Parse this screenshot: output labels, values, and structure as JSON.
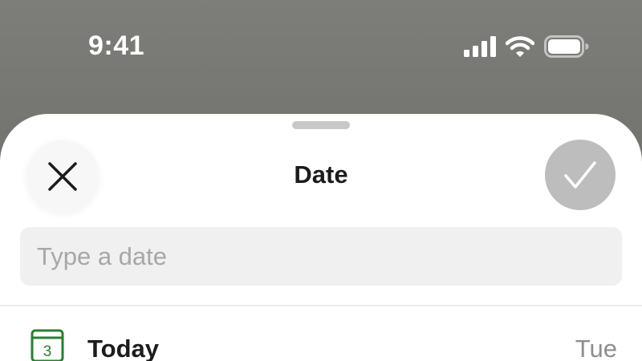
{
  "status_bar": {
    "time": "9:41",
    "icons": [
      "cellular-signal-icon",
      "wifi-icon",
      "battery-icon"
    ]
  },
  "sheet": {
    "title": "Date",
    "close_icon": "close-icon",
    "confirm_icon": "checkmark-icon"
  },
  "date_input": {
    "value": "",
    "placeholder": "Type a date"
  },
  "options": [
    {
      "icon": "calendar-icon",
      "icon_number": "3",
      "label": "Today",
      "day": "Tue"
    }
  ],
  "colors": {
    "backdrop": "#737470",
    "sheet": "#ffffff",
    "confirm_disabled": "#bdbdbd",
    "input_bg": "#f0f0f0",
    "calendar_green": "#2e7d32"
  }
}
